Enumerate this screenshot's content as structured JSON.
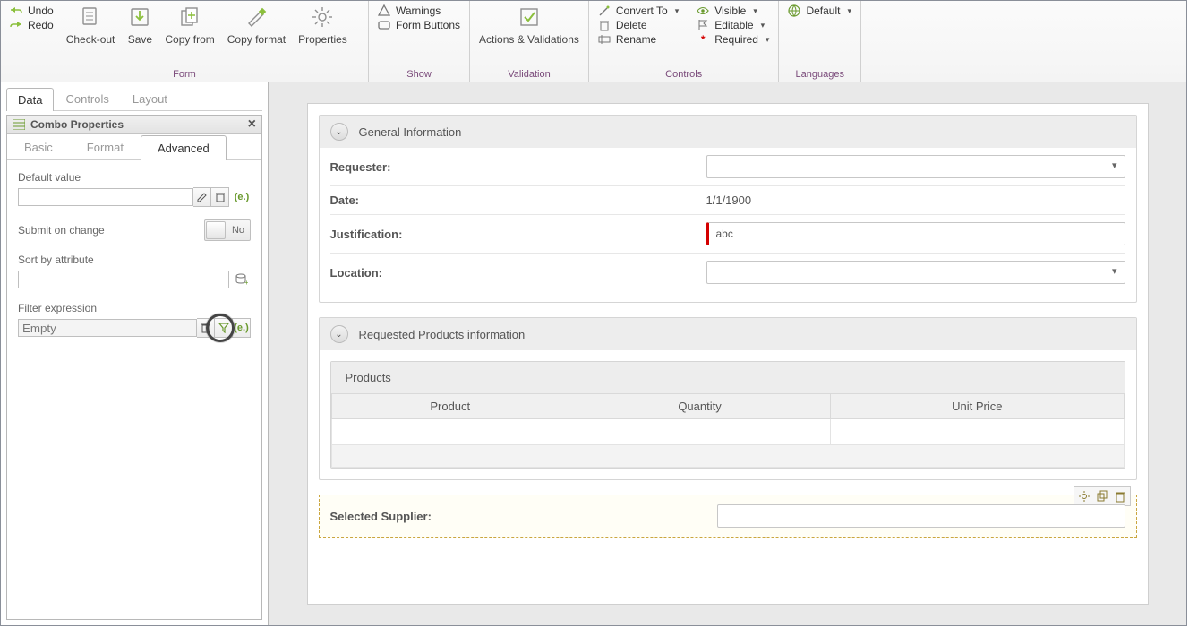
{
  "ribbon": {
    "form": {
      "title": "Form",
      "undo": "Undo",
      "redo": "Redo",
      "checkout": "Check-out",
      "save": "Save",
      "copy_from": "Copy from",
      "copy_format": "Copy format",
      "properties": "Properties"
    },
    "show": {
      "title": "Show",
      "warnings": "Warnings",
      "form_buttons": "Form Buttons"
    },
    "validation": {
      "title": "Validation",
      "actions_validations": "Actions & Validations"
    },
    "controls": {
      "title": "Controls",
      "convert_to": "Convert To",
      "delete": "Delete",
      "rename": "Rename",
      "visible": "Visible",
      "editable": "Editable",
      "required": "Required"
    },
    "languages": {
      "title": "Languages",
      "default": "Default"
    }
  },
  "left": {
    "tabs": {
      "data": "Data",
      "controls": "Controls",
      "layout": "Layout"
    },
    "panel_title": "Combo Properties",
    "subtabs": {
      "basic": "Basic",
      "format": "Format",
      "advanced": "Advanced"
    },
    "default_value_label": "Default value",
    "default_value": "",
    "submit_on_change_label": "Submit on change",
    "submit_on_change_value": "No",
    "sort_by_attribute_label": "Sort by attribute",
    "sort_by_attribute_value": "",
    "filter_expression_label": "Filter expression",
    "filter_expression_value": "Empty"
  },
  "form": {
    "section1_title": "General Information",
    "requester_label": "Requester:",
    "requester_value": "",
    "date_label": "Date:",
    "date_value": "1/1/1900",
    "justification_label": "Justification:",
    "justification_value": "abc",
    "location_label": "Location:",
    "location_value": "",
    "section2_title": "Requested Products information",
    "products_title": "Products",
    "col_product": "Product",
    "col_quantity": "Quantity",
    "col_unit_price": "Unit Price",
    "selected_supplier_label": "Selected Supplier:",
    "selected_supplier_value": ""
  }
}
